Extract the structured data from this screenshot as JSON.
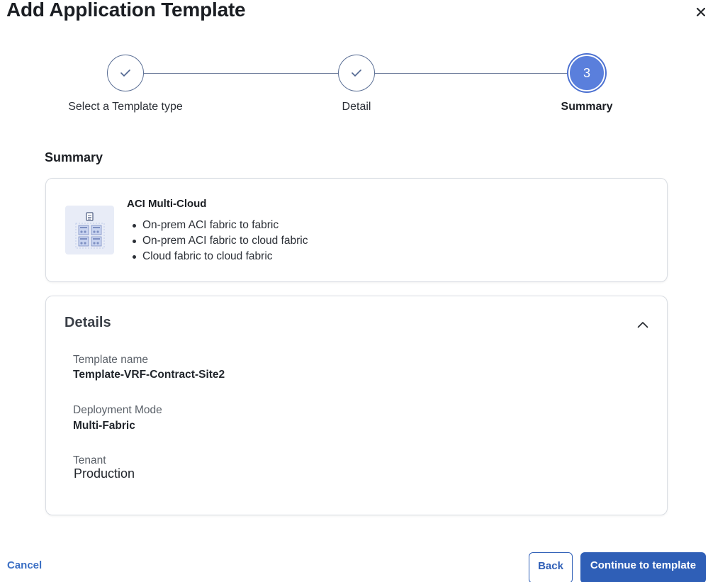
{
  "dialog": {
    "title": "Add Application Template"
  },
  "stepper": {
    "steps": [
      {
        "label": "Select a Template type",
        "state": "completed"
      },
      {
        "label": "Detail",
        "state": "completed"
      },
      {
        "label": "Summary",
        "state": "active",
        "number": "3"
      }
    ]
  },
  "summary": {
    "section_title": "Summary",
    "template": {
      "icon": "template-diagram-icon",
      "name": "ACI Multi-Cloud",
      "features": [
        "On-prem ACI fabric to fabric",
        "On-prem ACI fabric to cloud fabric",
        "Cloud fabric to cloud fabric"
      ]
    }
  },
  "details": {
    "title": "Details",
    "fields": {
      "template_name": {
        "label": "Template name",
        "value": "Template-VRF-Contract-Site2"
      },
      "deployment_mode": {
        "label": "Deployment Mode",
        "value": "Multi-Fabric"
      },
      "tenant": {
        "label": "Tenant",
        "value": "Production"
      }
    }
  },
  "footer": {
    "cancel_label": "Cancel",
    "back_label": "Back",
    "continue_label": "Continue to template"
  },
  "colors": {
    "primary": "#2f5fb7",
    "active_step": "#5a7fdc",
    "link": "#3b6fc4"
  }
}
